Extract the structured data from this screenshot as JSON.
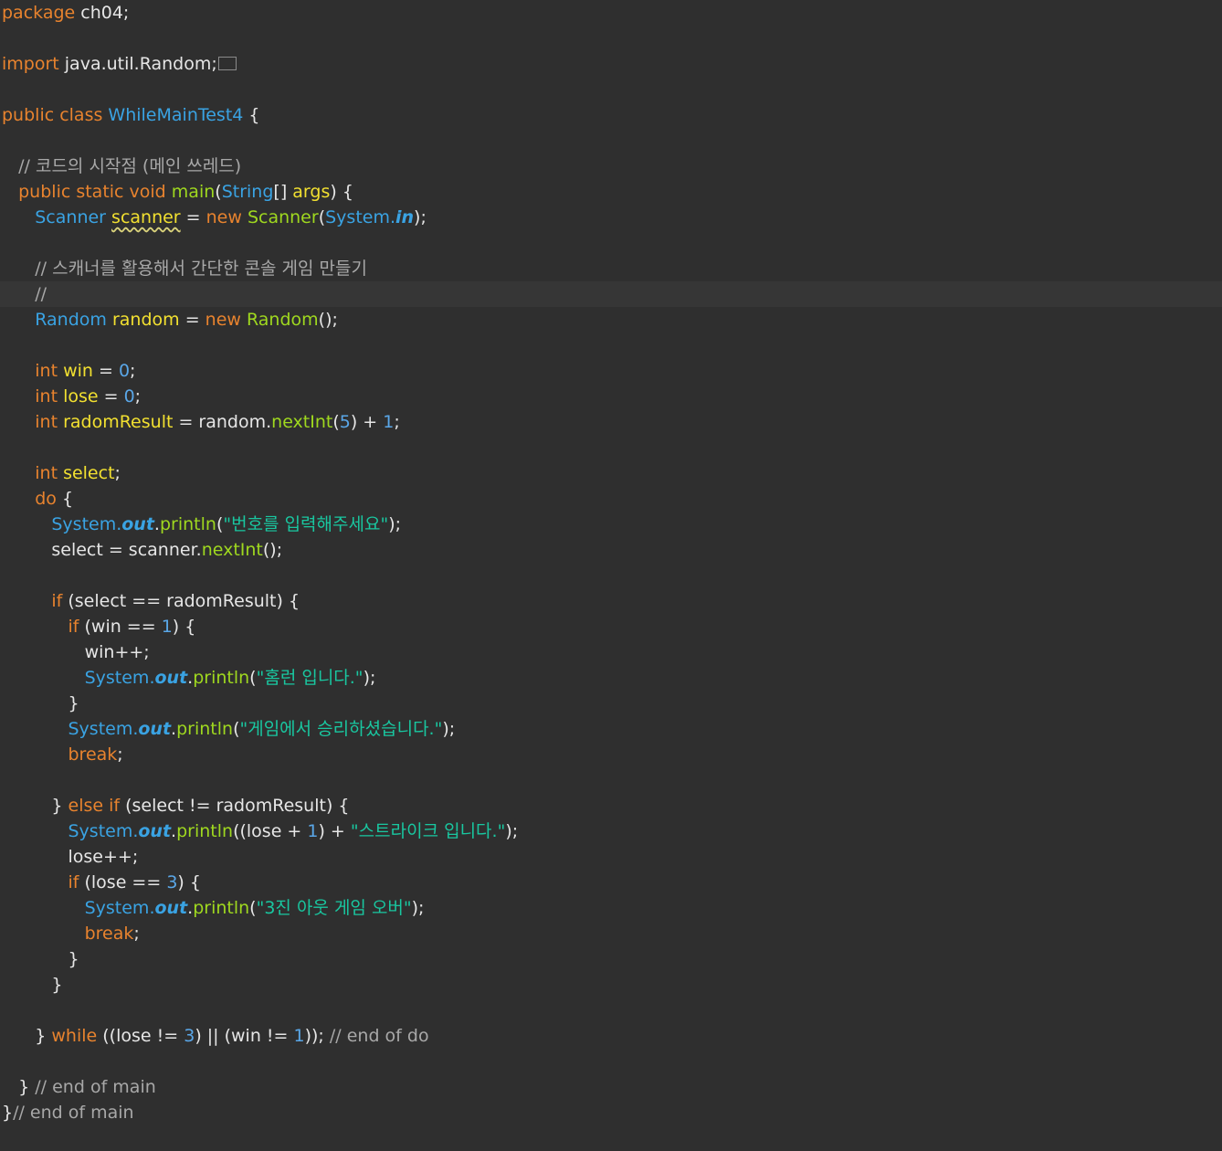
{
  "colors": {
    "background": "#2f2f2f",
    "current_line": "#363636",
    "default": "#e6e6e6",
    "keyword": "#e8832e",
    "class": "#3aa3e3",
    "variable": "#f2e030",
    "method": "#9fd81f",
    "string": "#19c7a0",
    "number": "#5aa7e8",
    "comment": "#a8a8a8",
    "static_field": "#3aa3e3"
  },
  "current_line_index": 11,
  "lines": [
    [
      [
        "package",
        "keyword"
      ],
      [
        " ch04;",
        "default"
      ]
    ],
    [],
    [
      [
        "import",
        "keyword"
      ],
      [
        " java.util.Random;",
        "default"
      ],
      [
        "",
        "fold"
      ]
    ],
    [],
    [
      [
        "public class ",
        "keyword"
      ],
      [
        "WhileMainTest4",
        "class"
      ],
      [
        " {",
        "default"
      ]
    ],
    [],
    [
      [
        "   ",
        "default"
      ],
      [
        "// 코드의 시작점 (메인 쓰레드)",
        "comment"
      ]
    ],
    [
      [
        "   ",
        "default"
      ],
      [
        "public static void ",
        "keyword"
      ],
      [
        "main",
        "method"
      ],
      [
        "(",
        "default"
      ],
      [
        "String",
        "class"
      ],
      [
        "[] ",
        "default"
      ],
      [
        "args",
        "variable"
      ],
      [
        ") {",
        "default"
      ]
    ],
    [
      [
        "      ",
        "default"
      ],
      [
        "Scanner",
        "class"
      ],
      [
        " ",
        "default"
      ],
      [
        "scanner",
        "var-squiggle"
      ],
      [
        " = ",
        "default"
      ],
      [
        "new ",
        "keyword"
      ],
      [
        "Scanner",
        "method"
      ],
      [
        "(",
        "default"
      ],
      [
        "System.",
        "class"
      ],
      [
        "in",
        "static"
      ],
      [
        ");",
        "default"
      ]
    ],
    [],
    [
      [
        "      ",
        "default"
      ],
      [
        "// 스캐너를 활용해서 간단한 콘솔 게임 만들기",
        "comment"
      ]
    ],
    [
      [
        "      ",
        "default"
      ],
      [
        "//",
        "comment"
      ]
    ],
    [
      [
        "      ",
        "default"
      ],
      [
        "Random",
        "class"
      ],
      [
        " ",
        "default"
      ],
      [
        "random",
        "variable"
      ],
      [
        " = ",
        "default"
      ],
      [
        "new ",
        "keyword"
      ],
      [
        "Random",
        "method"
      ],
      [
        "();",
        "default"
      ]
    ],
    [],
    [
      [
        "      ",
        "default"
      ],
      [
        "int ",
        "keyword"
      ],
      [
        "win",
        "variable"
      ],
      [
        " = ",
        "default"
      ],
      [
        "0",
        "number"
      ],
      [
        ";",
        "default"
      ]
    ],
    [
      [
        "      ",
        "default"
      ],
      [
        "int ",
        "keyword"
      ],
      [
        "lose",
        "variable"
      ],
      [
        " = ",
        "default"
      ],
      [
        "0",
        "number"
      ],
      [
        ";",
        "default"
      ]
    ],
    [
      [
        "      ",
        "default"
      ],
      [
        "int ",
        "keyword"
      ],
      [
        "radomResult",
        "variable"
      ],
      [
        " = random.",
        "default"
      ],
      [
        "nextInt",
        "method"
      ],
      [
        "(",
        "default"
      ],
      [
        "5",
        "number"
      ],
      [
        ") + ",
        "default"
      ],
      [
        "1",
        "number"
      ],
      [
        ";",
        "default"
      ]
    ],
    [],
    [
      [
        "      ",
        "default"
      ],
      [
        "int ",
        "keyword"
      ],
      [
        "select",
        "variable"
      ],
      [
        ";",
        "default"
      ]
    ],
    [
      [
        "      ",
        "default"
      ],
      [
        "do",
        "keyword"
      ],
      [
        " {",
        "default"
      ]
    ],
    [
      [
        "         ",
        "default"
      ],
      [
        "System.",
        "class"
      ],
      [
        "out",
        "static"
      ],
      [
        ".",
        "default"
      ],
      [
        "println",
        "method"
      ],
      [
        "(",
        "default"
      ],
      [
        "\"번호를 입력해주세요\"",
        "string"
      ],
      [
        ");",
        "default"
      ]
    ],
    [
      [
        "         ",
        "default"
      ],
      [
        "select = scanner.",
        "default"
      ],
      [
        "nextInt",
        "method"
      ],
      [
        "();",
        "default"
      ]
    ],
    [],
    [
      [
        "         ",
        "default"
      ],
      [
        "if",
        "keyword"
      ],
      [
        " (select == radomResult) {",
        "default"
      ]
    ],
    [
      [
        "            ",
        "default"
      ],
      [
        "if",
        "keyword"
      ],
      [
        " (win == ",
        "default"
      ],
      [
        "1",
        "number"
      ],
      [
        ") {",
        "default"
      ]
    ],
    [
      [
        "               ",
        "default"
      ],
      [
        "win++;",
        "default"
      ]
    ],
    [
      [
        "               ",
        "default"
      ],
      [
        "System.",
        "class"
      ],
      [
        "out",
        "static"
      ],
      [
        ".",
        "default"
      ],
      [
        "println",
        "method"
      ],
      [
        "(",
        "default"
      ],
      [
        "\"홈런 입니다.\"",
        "string"
      ],
      [
        ");",
        "default"
      ]
    ],
    [
      [
        "            ",
        "default"
      ],
      [
        "}",
        "default"
      ]
    ],
    [
      [
        "            ",
        "default"
      ],
      [
        "System.",
        "class"
      ],
      [
        "out",
        "static"
      ],
      [
        ".",
        "default"
      ],
      [
        "println",
        "method"
      ],
      [
        "(",
        "default"
      ],
      [
        "\"게임에서 승리하셨습니다.\"",
        "string"
      ],
      [
        ");",
        "default"
      ]
    ],
    [
      [
        "            ",
        "default"
      ],
      [
        "break",
        "keyword"
      ],
      [
        ";",
        "default"
      ]
    ],
    [],
    [
      [
        "         ",
        "default"
      ],
      [
        "} ",
        "default"
      ],
      [
        "else if",
        "keyword"
      ],
      [
        " (select != radomResult) {",
        "default"
      ]
    ],
    [
      [
        "            ",
        "default"
      ],
      [
        "System.",
        "class"
      ],
      [
        "out",
        "static"
      ],
      [
        ".",
        "default"
      ],
      [
        "println",
        "method"
      ],
      [
        "((lose + ",
        "default"
      ],
      [
        "1",
        "number"
      ],
      [
        ") + ",
        "default"
      ],
      [
        "\"스트라이크 입니다.\"",
        "string"
      ],
      [
        ");",
        "default"
      ]
    ],
    [
      [
        "            ",
        "default"
      ],
      [
        "lose++;",
        "default"
      ]
    ],
    [
      [
        "            ",
        "default"
      ],
      [
        "if",
        "keyword"
      ],
      [
        " (lose == ",
        "default"
      ],
      [
        "3",
        "number"
      ],
      [
        ") {",
        "default"
      ]
    ],
    [
      [
        "               ",
        "default"
      ],
      [
        "System.",
        "class"
      ],
      [
        "out",
        "static"
      ],
      [
        ".",
        "default"
      ],
      [
        "println",
        "method"
      ],
      [
        "(",
        "default"
      ],
      [
        "\"3진 아웃 게임 오버\"",
        "string"
      ],
      [
        ");",
        "default"
      ]
    ],
    [
      [
        "               ",
        "default"
      ],
      [
        "break",
        "keyword"
      ],
      [
        ";",
        "default"
      ]
    ],
    [
      [
        "            ",
        "default"
      ],
      [
        "}",
        "default"
      ]
    ],
    [
      [
        "         ",
        "default"
      ],
      [
        "}",
        "default"
      ]
    ],
    [],
    [
      [
        "      ",
        "default"
      ],
      [
        "} ",
        "default"
      ],
      [
        "while",
        "keyword"
      ],
      [
        " ((lose != ",
        "default"
      ],
      [
        "3",
        "number"
      ],
      [
        ") || (win != ",
        "default"
      ],
      [
        "1",
        "number"
      ],
      [
        ")); ",
        "default"
      ],
      [
        "// end of do",
        "comment"
      ]
    ],
    [],
    [
      [
        "   ",
        "default"
      ],
      [
        "} ",
        "default"
      ],
      [
        "// end of main",
        "comment"
      ]
    ],
    [
      [
        "}",
        "default"
      ],
      [
        "// end of main",
        "comment"
      ]
    ]
  ]
}
